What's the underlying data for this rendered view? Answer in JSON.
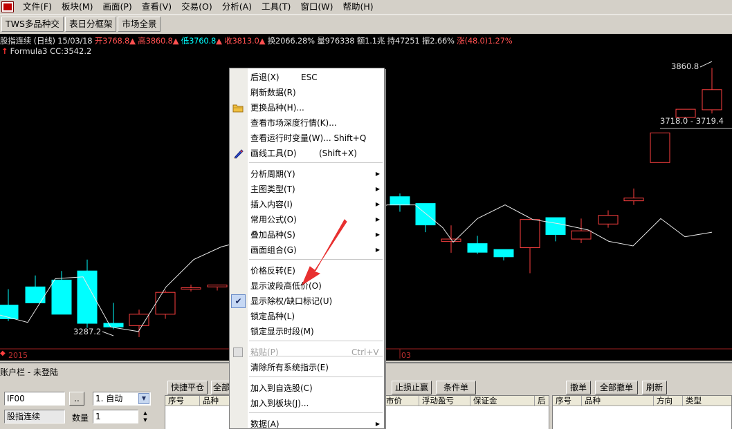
{
  "menubar": {
    "items": [
      "文件(F)",
      "板块(M)",
      "画面(P)",
      "查看(V)",
      "交易(O)",
      "分析(A)",
      "工具(T)",
      "窗口(W)",
      "帮助(H)"
    ]
  },
  "tabs": [
    "TWS多品种交",
    "表日分框架",
    "市场全景"
  ],
  "chart": {
    "info": {
      "name": "股指连续 (日线)",
      "date": "15/03/18",
      "open": "开3768.8",
      "high": "高3860.8",
      "low": "低3760.8",
      "close": "收3813.0",
      "turnover": "换2066.28%",
      "volume": "量976338",
      "amount": "额1.1兆",
      "position": "持47251",
      "amplitude": "振2.66%",
      "change": "涨(48.0)1.27%"
    },
    "formula": "Formula3 CC:3542.2",
    "low_label": "3287.2",
    "high_label": "3860.8",
    "gap_label": "3718.0 - 3719.4",
    "date_labels": [
      "2015",
      "03"
    ]
  },
  "chart_data": {
    "type": "candlestick",
    "series": [
      {
        "o": 3340,
        "h": 3375,
        "l": 3305,
        "c": 3310
      },
      {
        "o": 3380,
        "h": 3405,
        "l": 3345,
        "c": 3345
      },
      {
        "o": 3395,
        "h": 3415,
        "l": 3320,
        "c": 3320
      },
      {
        "o": 3415,
        "h": 3440,
        "l": 3290,
        "c": 3300
      },
      {
        "o": 3300,
        "h": 3345,
        "l": 3287.2,
        "c": 3292
      },
      {
        "o": 3295,
        "h": 3330,
        "l": 3270,
        "c": 3320
      },
      {
        "o": 3320,
        "h": 3372,
        "l": 3310,
        "c": 3368
      },
      {
        "o": 3375,
        "h": 3385,
        "l": 3370,
        "c": 3378
      },
      {
        "o": 3380,
        "h": 3385,
        "l": 3372,
        "c": 3384
      },
      {
        "o": 3578,
        "h": 3585,
        "l": 3545,
        "c": 3560
      },
      {
        "o": 3563,
        "h": 3563,
        "l": 3500,
        "c": 3516
      },
      {
        "o": 3480,
        "h": 3515,
        "l": 3455,
        "c": 3485
      },
      {
        "o": 3475,
        "h": 3492,
        "l": 3452,
        "c": 3456
      },
      {
        "o": 3462,
        "h": 3456,
        "l": 3438,
        "c": 3446
      },
      {
        "o": 3466,
        "h": 3530,
        "l": 3410,
        "c": 3528
      },
      {
        "o": 3532,
        "h": 3532,
        "l": 3480,
        "c": 3495
      },
      {
        "o": 3485,
        "h": 3530,
        "l": 3476,
        "c": 3503
      },
      {
        "o": 3518,
        "h": 3548,
        "l": 3510,
        "c": 3537
      },
      {
        "o": 3569,
        "h": 3596,
        "l": 3560,
        "c": 3575
      },
      {
        "o": 3653,
        "h": 3718.0,
        "l": 3653,
        "c": 3718.0
      },
      {
        "o": 3752,
        "h": 3770,
        "l": 3752,
        "c": 3770
      },
      {
        "o": 3768.8,
        "h": 3860.8,
        "l": 3760.8,
        "c": 3813.0
      }
    ],
    "line": [
      3318,
      3302,
      3398,
      3402,
      3292,
      3282,
      3380,
      3440,
      3468,
      3560,
      3560,
      3510,
      3478,
      3530,
      3560,
      3528,
      3518,
      3505,
      3480,
      3470,
      3530,
      3490,
      3500
    ],
    "ylim": [
      3250,
      3890
    ]
  },
  "context_menu": {
    "items": [
      {
        "label": "后退(X)",
        "shortcut": "ESC"
      },
      {
        "label": "刷新数据(R)"
      },
      {
        "label": "更换品种(H)...",
        "icon": "folder-icon"
      },
      {
        "label": "查看市场深度行情(K)..."
      },
      {
        "label": "查看运行时变量(W)... Shift+Q"
      },
      {
        "label": "画线工具(D)",
        "shortcut": "(Shift+X)",
        "icon": "pencil-icon"
      },
      {
        "label": "分析周期(Y)",
        "submenu": true
      },
      {
        "label": "主图类型(T)",
        "submenu": true
      },
      {
        "label": "插入内容(I)",
        "submenu": true
      },
      {
        "label": "常用公式(O)",
        "submenu": true
      },
      {
        "label": "叠加品种(S)",
        "submenu": true
      },
      {
        "label": "画面组合(G)",
        "submenu": true
      },
      {
        "label": "价格反转(E)"
      },
      {
        "label": "显示波段高低价(O)"
      },
      {
        "label": "显示除权/缺口标记(U)",
        "checked": true
      },
      {
        "label": "锁定品种(L)"
      },
      {
        "label": "锁定显示时段(M)"
      },
      {
        "label": "粘贴(P)",
        "shortcut": "Ctrl+V",
        "disabled": true
      },
      {
        "label": "清除所有系统指示(E)"
      },
      {
        "label": "加入到自选股(C)"
      },
      {
        "label": "加入到板块(J)..."
      },
      {
        "label": "数据(A)",
        "submenu": true
      }
    ]
  },
  "bottom": {
    "account_bar": "账户栏 - 未登陆",
    "code_input": "IF00",
    "browse_button": "..",
    "mode_select": "1. 自动",
    "name_field": "股指连续",
    "qty_label": "数量",
    "qty_value": "1",
    "buttons_left": [
      "快捷平仓",
      "全部"
    ],
    "buttons_mid": [
      "止损止赢",
      "条件单"
    ],
    "buttons_right": [
      "撤单",
      "全部撤单",
      "刷新"
    ],
    "grid1_headers": [
      "序号",
      "品种"
    ],
    "grid2_headers": [
      "市价",
      "浮动盈亏",
      "保证金",
      "后"
    ],
    "grid3_headers": [
      "序号",
      "品种",
      "方向",
      "类型"
    ]
  }
}
